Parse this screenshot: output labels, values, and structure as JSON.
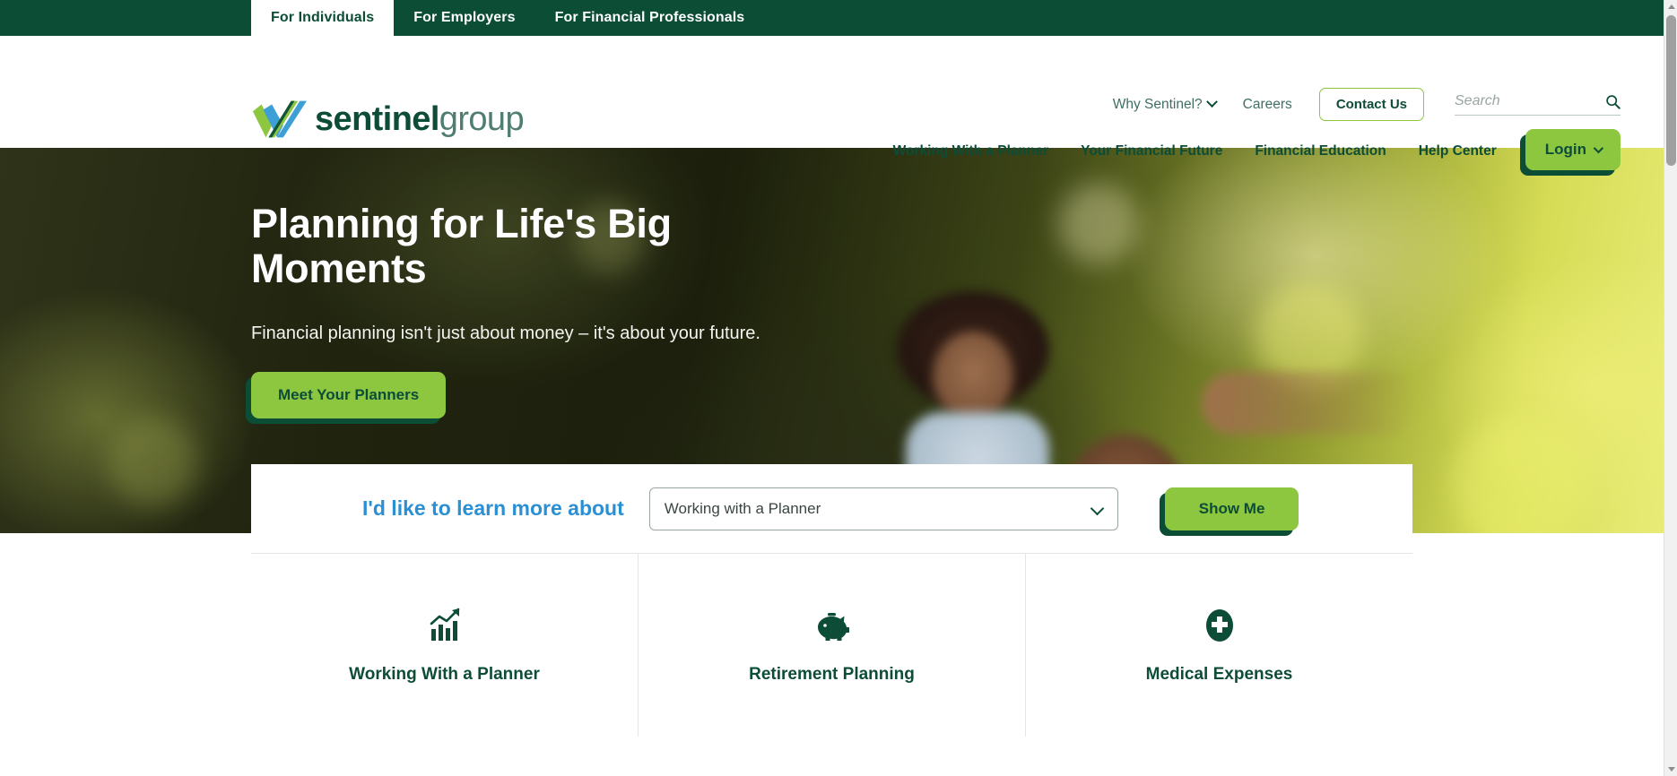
{
  "audience_bar": {
    "tabs": [
      {
        "label": "For Individuals",
        "active": true
      },
      {
        "label": "For Employers",
        "active": false
      },
      {
        "label": "For Financial Professionals",
        "active": false
      }
    ]
  },
  "header": {
    "logo": {
      "name_bold": "sentinel",
      "name_light": "group",
      "mark_colors": {
        "dark_green": "#0d4d38",
        "light_green": "#8dc63f",
        "blue": "#3d9fd6"
      }
    },
    "utility": {
      "why_sentinel": "Why Sentinel?",
      "careers": "Careers",
      "contact_us": "Contact Us"
    },
    "search": {
      "placeholder": "Search",
      "value": "",
      "icon": "search-icon"
    },
    "nav": [
      "Working With a Planner",
      "Your Financial Future",
      "Financial Education",
      "Help Center"
    ],
    "login": {
      "label": "Login",
      "icon": "chevron-down-icon"
    }
  },
  "hero": {
    "title": "Planning for Life's Big Moments",
    "subtitle": "Financial planning isn't just about money – it's about your future.",
    "cta": "Meet Your Planners"
  },
  "selector": {
    "label": "I'd like to learn more about",
    "selected": "Working with a Planner",
    "options": [
      "Working with a Planner",
      "Retirement Planning",
      "Medical Expenses"
    ],
    "button": "Show Me"
  },
  "feature_cards": [
    {
      "title": "Working With a Planner",
      "icon": "growth-chart-icon"
    },
    {
      "title": "Retirement Planning",
      "icon": "piggy-bank-icon"
    },
    {
      "title": "Medical Expenses",
      "icon": "medical-cross-icon"
    }
  ],
  "colors": {
    "brand_dark_green": "#0b4d35",
    "brand_light_green": "#8dc63f",
    "accent_blue": "#2b8fd3",
    "text_green": "#0d4d38"
  }
}
